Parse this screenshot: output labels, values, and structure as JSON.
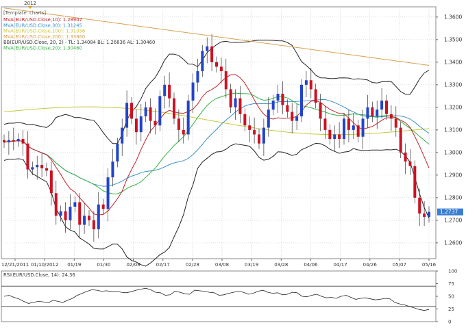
{
  "top_marker": {
    "label": "2012"
  },
  "template_label": "[Template: charts]",
  "indicators": [
    {
      "text": "MVA(EUR/USD.Close,10): 1.28907",
      "color": "#c0202a"
    },
    {
      "text": "MVA(EUR/USD.Close,30): 1.31245",
      "color": "#3a8fc8"
    },
    {
      "text": "MVA(EUR/USD.Close,100): 1.31036",
      "color": "#c8c83a"
    },
    {
      "text": "MVA(EUR/USD.Close,200): 1.33860",
      "color": "#d9a050"
    },
    {
      "text": "BB(EUR/USD.Close, 20, 2)  -  TL: 1.34084  BL: 1.26836  AL: 1.30460",
      "color": "#333333"
    },
    {
      "text": "MVA(EUR/USD.Close,20): 1.30460",
      "color": "#33b040"
    }
  ],
  "price_badge": "1.2737",
  "rsi_label": "RSI(EUR/USD.Close, 14): 24.36",
  "colors": {
    "up": "#2244cc",
    "down": "#cc1122",
    "bb": "#222222",
    "ma10": "#c0202a",
    "ma30": "#3a8fc8",
    "ma100": "#c8c83a",
    "ma200": "#d9a050",
    "ma20": "#33b040",
    "badge": "#3a7ed0"
  },
  "chart_data": {
    "type": "candlestick",
    "y_axis": {
      "ticks": [
        "1.3600",
        "1.3500",
        "1.3400",
        "1.3300",
        "1.3200",
        "1.3100",
        "1.3000",
        "1.2900",
        "1.2800",
        "1.2700",
        "1.2600"
      ],
      "range": [
        1.253,
        1.3645
      ]
    },
    "x_axis": {
      "ticks": [
        "12/21/2011",
        "01/10/2012",
        "01/19",
        "01/30",
        "02/08",
        "02/17",
        "02/28",
        "03/08",
        "03/19",
        "03/28",
        "04/06",
        "04/17",
        "04/26",
        "05/07",
        "05/16"
      ]
    },
    "closes": [
      1.3045,
      1.3055,
      1.305,
      1.306,
      1.304,
      1.2925,
      1.2935,
      1.2945,
      1.293,
      1.292,
      1.282,
      1.272,
      1.274,
      1.27,
      1.276,
      1.278,
      1.268,
      1.272,
      1.27,
      1.266,
      1.277,
      1.275,
      1.289,
      1.296,
      1.304,
      1.311,
      1.322,
      1.315,
      1.309,
      1.316,
      1.32,
      1.314,
      1.312,
      1.325,
      1.33,
      1.324,
      1.315,
      1.31,
      1.308,
      1.323,
      1.331,
      1.336,
      1.345,
      1.347,
      1.34,
      1.338,
      1.336,
      1.328,
      1.32,
      1.324,
      1.317,
      1.312,
      1.31,
      1.308,
      1.304,
      1.311,
      1.319,
      1.323,
      1.326,
      1.321,
      1.318,
      1.314,
      1.316,
      1.33,
      1.332,
      1.328,
      1.322,
      1.315,
      1.31,
      1.306,
      1.308,
      1.306,
      1.315,
      1.31,
      1.312,
      1.307,
      1.315,
      1.32,
      1.316,
      1.319,
      1.323,
      1.317,
      1.315,
      1.311,
      1.3,
      1.296,
      1.294,
      1.28,
      1.273,
      1.2715,
      1.2737
    ],
    "ma": {
      "ma10_last": 1.28907,
      "ma30_last": 1.31245,
      "ma100_last": 1.31036,
      "ma200_last": 1.3386,
      "ma20_last": 1.3046
    },
    "bb": {
      "period": 20,
      "stddev": 2,
      "top": 1.34084,
      "bottom": 1.26836,
      "avg": 1.3046
    },
    "rsi": {
      "period": 14,
      "value": 24.36,
      "ticks": [
        "100",
        "75",
        "50",
        "25",
        "0"
      ],
      "levels": [
        70,
        30
      ],
      "values": [
        50,
        52,
        48,
        45,
        40,
        36,
        38,
        40,
        39,
        37,
        42,
        40,
        38,
        42,
        46,
        52,
        56,
        60,
        63,
        62,
        60,
        61,
        59,
        60,
        58,
        57,
        59,
        62,
        64,
        66,
        63,
        58,
        57,
        52,
        53,
        60,
        58,
        55,
        54,
        62,
        61,
        60,
        58,
        57,
        52,
        53,
        56,
        58,
        60,
        58,
        54,
        56,
        60,
        62,
        58,
        56,
        57,
        53,
        54,
        58,
        57,
        50,
        49,
        52,
        54,
        50,
        47,
        48,
        46,
        50,
        52,
        48,
        44,
        46,
        47,
        45,
        43,
        44,
        46,
        45,
        38,
        35,
        33,
        30,
        27,
        24,
        22,
        24
      ]
    }
  }
}
